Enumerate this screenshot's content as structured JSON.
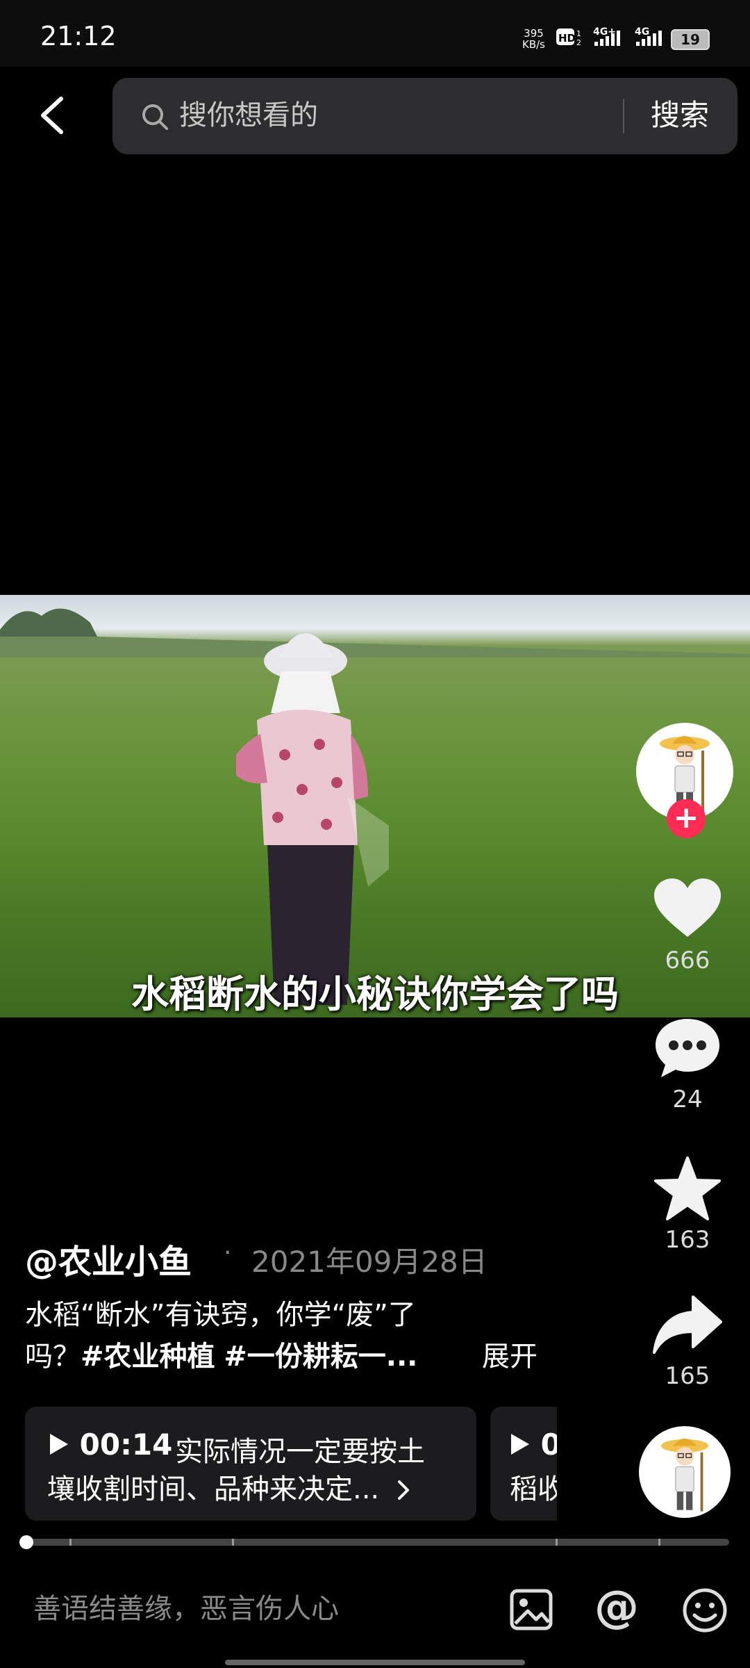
{
  "status_bar": {
    "time": "21:12",
    "network_speed_value": "395",
    "network_speed_unit": "KB/s",
    "signal1": "4G+",
    "signal2": "4G",
    "battery": "19"
  },
  "search": {
    "placeholder": "搜你想看的",
    "button_label": "搜索"
  },
  "video": {
    "subtitle": "水稻断水的小秘诀你学会了吗",
    "progress_fraction": 0.0
  },
  "actions": {
    "likes": "666",
    "comments": "24",
    "favorites": "163",
    "shares": "165"
  },
  "post": {
    "author": "@农业小鱼",
    "separator": "·",
    "date": "2021年09月28日",
    "desc_line1": "水稻“断水”有诀窍，你学“废”了",
    "desc_line2_prefix": "吗？",
    "tag1": "#农业种植",
    "tag2": "#一份耕耘一...",
    "expand_label": "展开"
  },
  "chapters": [
    {
      "time": "00:14",
      "line1": "实际情况一定要按土",
      "line2": "壤收割时间、品种来决定..."
    },
    {
      "time": "0",
      "line2": "稻收"
    }
  ],
  "comment_bar": {
    "placeholder": "善语结善缘，恶言伤人心"
  },
  "colors": {
    "accent": "#fe2c55",
    "background": "#000000",
    "search_bg": "#2d2d2f"
  }
}
